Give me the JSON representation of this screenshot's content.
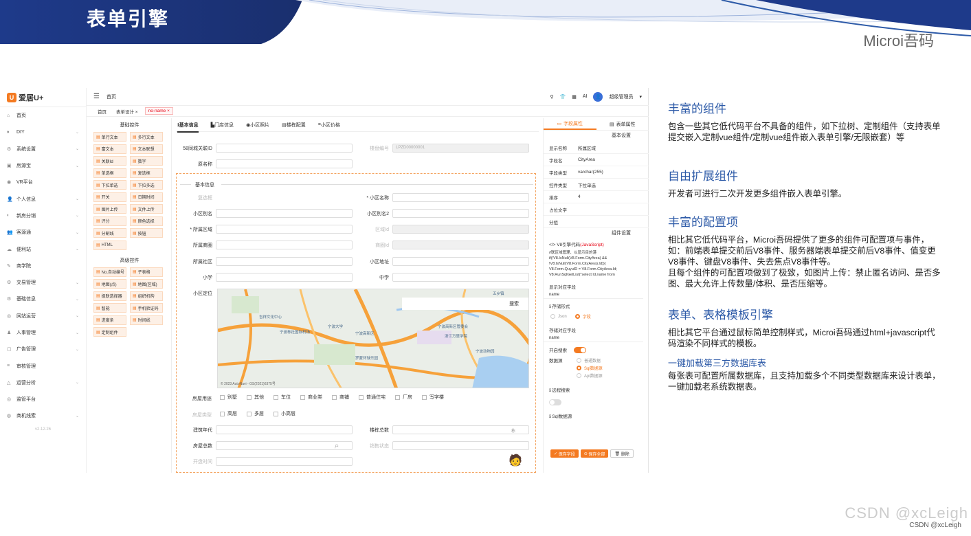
{
  "slide": {
    "title": "表单引擎",
    "brand": "Microi吾码",
    "watermark": "CSDN @xcLeigh",
    "watermark_small": "CSDN @xcLeigh"
  },
  "app": {
    "logo_text": "爱居U+",
    "version": "v2.12.26",
    "sidebar": [
      {
        "label": "首页",
        "icon": "home-icon",
        "chev": ""
      },
      {
        "label": "DIY",
        "icon": "diy-icon",
        "chev": "⌄"
      },
      {
        "label": "系统设置",
        "icon": "gear-icon",
        "chev": "⌄"
      },
      {
        "label": "房源宝",
        "icon": "house-icon",
        "chev": "⌄"
      },
      {
        "label": "VR平台",
        "icon": "vr-icon",
        "chev": ""
      },
      {
        "label": "个人信息",
        "icon": "user-icon",
        "chev": "⌄"
      },
      {
        "label": "新房分销",
        "icon": "share-icon",
        "chev": "⌄"
      },
      {
        "label": "客源通",
        "icon": "people-icon",
        "chev": "⌄"
      },
      {
        "label": "便利站",
        "icon": "cloud-icon",
        "chev": "⌄"
      },
      {
        "label": "商学院",
        "icon": "school-icon",
        "chev": ""
      },
      {
        "label": "交易管理",
        "icon": "trade-icon",
        "chev": "⌄"
      },
      {
        "label": "基础信息",
        "icon": "info-icon",
        "chev": "⌄"
      },
      {
        "label": "网站运营",
        "icon": "globe-icon",
        "chev": "⌄"
      },
      {
        "label": "人事管理",
        "icon": "hr-icon",
        "chev": "⌄"
      },
      {
        "label": "广告管理",
        "icon": "ad-icon",
        "chev": "⌄"
      },
      {
        "label": "审核管理",
        "icon": "audit-icon",
        "chev": ""
      },
      {
        "label": "运营分析",
        "icon": "chart-icon",
        "chev": "⌄"
      },
      {
        "label": "监管平台",
        "icon": "eye-icon",
        "chev": ""
      },
      {
        "label": "商机线索",
        "icon": "clue-icon",
        "chev": "⌄"
      }
    ],
    "topbar": {
      "home": "首页",
      "user": "超级管理员"
    },
    "tabs": [
      {
        "label": "首页",
        "active": false
      },
      {
        "label": "表单设计 ×",
        "active": false
      },
      {
        "label": "no-name ×",
        "active": true
      }
    ],
    "palette": {
      "basic_title": "基础控件",
      "basic": [
        "单行文本",
        "多行文本",
        "富文本",
        "文本联想",
        "关联Id",
        "数字",
        "单选框",
        "复选框",
        "下拉单选",
        "下拉多选",
        "开关",
        "日期时间",
        "图片上传",
        "文件上传",
        "评分",
        "颜色选择",
        "分割线",
        "按钮",
        "HTML"
      ],
      "advanced_title": "高级控件",
      "advanced": [
        "No.自动编号",
        "子表格",
        "地图(点)",
        "地图(区域)",
        "级联选择器",
        "组织机构",
        "智能",
        "手机验证码",
        "进度条",
        "时间线",
        "定制组件"
      ]
    },
    "form": {
      "tabs": [
        "基本信息",
        "门店信息",
        "小区照片",
        "楼栋配置",
        "小区价格"
      ],
      "fields": {
        "f58id": "58同城关联ID",
        "loupan": "楼盘编号",
        "loupan_val": "LPZD00000001",
        "oldname": "原名称",
        "section": "基本信息",
        "fujian": "复选框",
        "xqname": "小区名称",
        "xqalias": "小区别名",
        "xqalias2": "小区别名2",
        "area": "所属区域",
        "areaid": "区域Id",
        "shangquan": "所属商圈",
        "shangquanid": "商圈Id",
        "shequ": "所属社区",
        "xqaddr": "小区地址",
        "xiaoxue": "小学",
        "zhongxue": "中学",
        "xqdingwei": "小区定位",
        "map_search": "搜索",
        "map_copy": "© 2023 AutoNavi - GS(2021)6375号",
        "map_labels": [
          "宁波栎社国际机场",
          "吉祥文化中心",
          "宁波高新区",
          "宁波大学",
          "罗蒙环球乐园",
          "宁波动物园",
          "五乡镇",
          "宁波高新区管委会",
          "浙江万里学院"
        ],
        "usage_label": "房屋用途",
        "usage": [
          "别墅",
          "其他",
          "车位",
          "商业类",
          "商铺",
          "普通住宅",
          "厂房",
          "写字楼"
        ],
        "type_label": "房屋类型",
        "types": [
          "高层",
          "多层",
          "小高层"
        ],
        "year": "建筑年代",
        "lou": "楼栋总数",
        "lou_unit": "栋",
        "hu": "房屋总数",
        "hu_unit": "户",
        "sale": "销售状态",
        "kaipan": "开盘时间"
      }
    },
    "props": {
      "tabs": [
        "字段属性",
        "表单属性"
      ],
      "basic_section": "基本设置",
      "rows": [
        {
          "k": "显示名称",
          "v": "所属区域"
        },
        {
          "k": "字段名",
          "v": "CityArea"
        },
        {
          "k": "字段类型",
          "v": "varchar(255)"
        },
        {
          "k": "控件类型",
          "v": "下拉单选"
        },
        {
          "k": "排序",
          "v": "4"
        },
        {
          "k": "占位文字",
          "v": ""
        },
        {
          "k": "分组",
          "v": ""
        }
      ],
      "comp_section": "组件设置",
      "v8_title": "V8引擎代码",
      "v8_lang": "(JavaScript)",
      "code": [
        "//联区域管理、以显示目的港",
        "if(!V8.IsNull(V8.Form.CityArea) &&",
        "!V8.IsNull(V8.Form.CityArea).Id)){",
        "  V8.Form.QuyuID = V8.Form.CityArea.Id;",
        "  V8.RunSqlGetList(\"select Id,name  from"
      ],
      "display_field": "显示对应字段",
      "display_val": "name",
      "store_form": "存储形式",
      "store_json": "Json",
      "store_field": "字段",
      "store_map": "存储对应字段",
      "store_val": "name",
      "remote_search": "开启搜索",
      "datasource": "数据源",
      "ds_opts": [
        "普通数据",
        "Sql数据源",
        "Api数据源"
      ],
      "remote": "远程搜索",
      "sqlds": "Sql数据源",
      "btn_save_field": "保存字段",
      "btn_save_all": "保存全部",
      "btn_delete": "删除"
    }
  },
  "right": {
    "s1_title": "丰富的组件",
    "s1_text": "包含一些其它低代码平台不具备的组件，如下拉树、定制组件（支持表单提交嵌入定制vue组件/定制vue组件嵌入表单引擎/无限嵌套）等",
    "s2_title": "自由扩展组件",
    "s2_text": "开发者可进行二次开发更多组件嵌入表单引擎。",
    "s3_title": "丰富的配置项",
    "s3_text": "相比其它低代码平台，Microi吾码提供了更多的组件可配置项与事件，如：前端表单提交前后V8事件、服务器端表单提交前后V8事件、值变更V8事件、键盘V8事件、失去焦点V8事件等。",
    "s3_text2": "且每个组件的可配置项做到了极致，如图片上传：禁止匿名访问、是否多图、最大允许上传数量/体积、是否压缩等。",
    "s4_title": "表单、表格模板引擎",
    "s4_text": "相比其它平台通过鼠标简单控制样式，Microi吾码通过html+javascript代码渲染不同样式的模板。",
    "s5_title": "一键加载第三方数据库表",
    "s5_text": "每张表可配置所属数据库，且支持加载多个不同类型数据库来设计表单，一键加载老系统数据表。"
  }
}
